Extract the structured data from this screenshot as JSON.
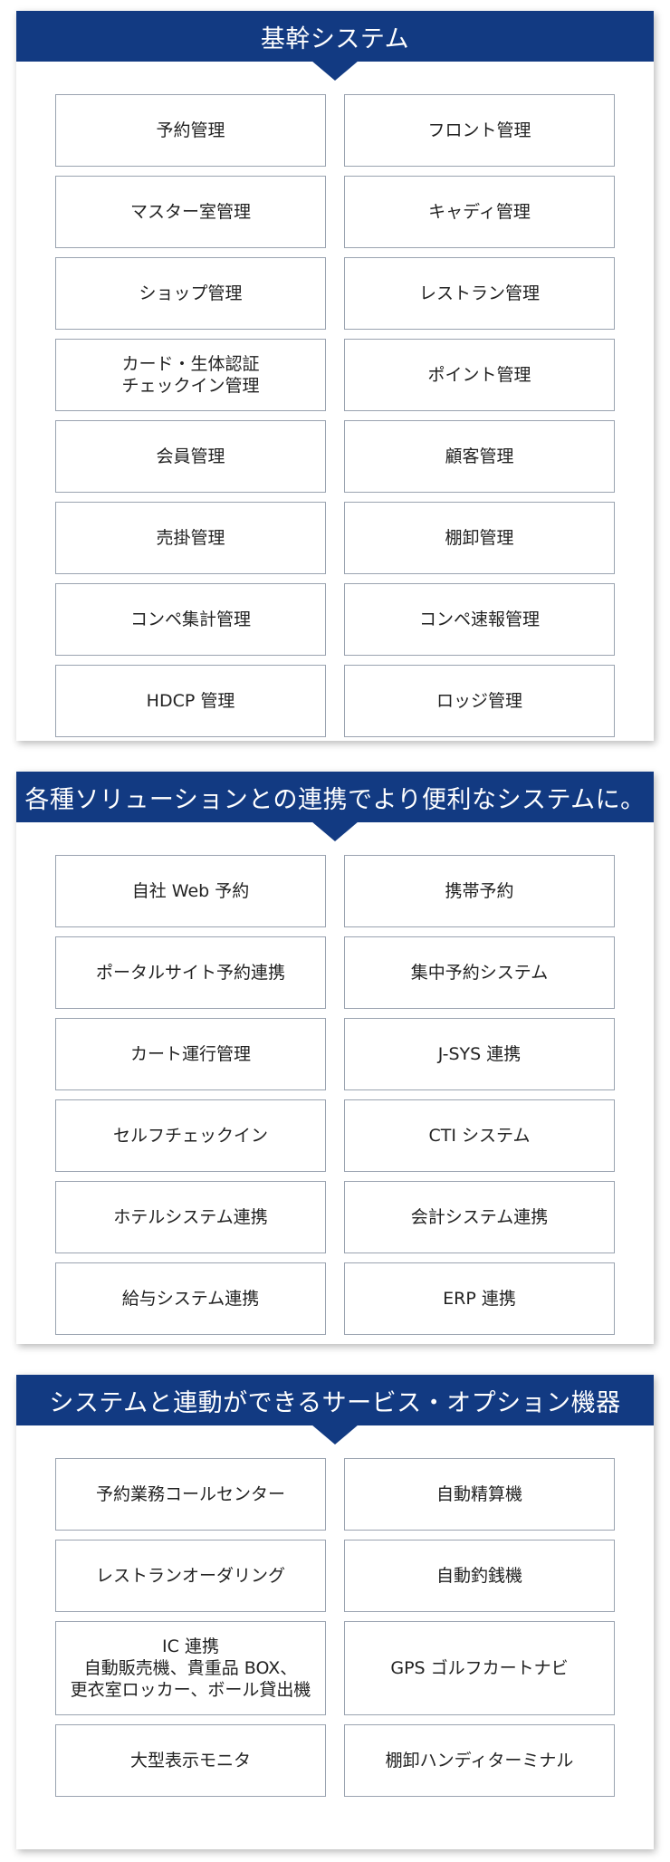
{
  "sections": [
    {
      "title": "基幹システム",
      "items": [
        [
          "予約管理"
        ],
        [
          "フロント管理"
        ],
        [
          "マスター室管理"
        ],
        [
          "キャディ管理"
        ],
        [
          "ショップ管理"
        ],
        [
          "レストラン管理"
        ],
        [
          "カード・生体認証",
          "チェックイン管理"
        ],
        [
          "ポイント管理"
        ],
        [
          "会員管理"
        ],
        [
          "顧客管理"
        ],
        [
          "売掛管理"
        ],
        [
          "棚卸管理"
        ],
        [
          "コンペ集計管理"
        ],
        [
          "コンペ速報管理"
        ],
        [
          "HDCP 管理"
        ],
        [
          "ロッジ管理"
        ]
      ]
    },
    {
      "title": "各種ソリューションとの連携でより便利なシステムに。",
      "items": [
        [
          "自社 Web 予約"
        ],
        [
          "携帯予約"
        ],
        [
          "ポータルサイト予約連携"
        ],
        [
          "集中予約システム"
        ],
        [
          "カート運行管理"
        ],
        [
          "J-SYS 連携"
        ],
        [
          "セルフチェックイン"
        ],
        [
          "CTI システム"
        ],
        [
          "ホテルシステム連携"
        ],
        [
          "会計システム連携"
        ],
        [
          "給与システム連携"
        ],
        [
          "ERP 連携"
        ]
      ]
    },
    {
      "title": "システムと連動ができるサービス・オプション機器",
      "items": [
        [
          "予約業務コールセンター"
        ],
        [
          "自動精算機"
        ],
        [
          "レストランオーダリング"
        ],
        [
          "自動釣銭機"
        ],
        [
          "IC 連携",
          "自動販売機、貴重品 BOX、",
          "更衣室ロッカー、ボール貸出機"
        ],
        [
          "GPS ゴルフカートナビ"
        ],
        [
          "大型表示モニタ"
        ],
        [
          "棚卸ハンディターミナル"
        ]
      ]
    }
  ]
}
